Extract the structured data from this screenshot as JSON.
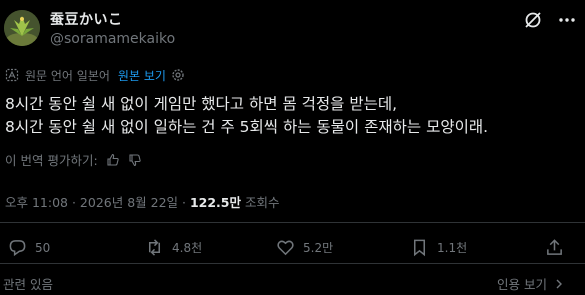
{
  "author": {
    "display_name": "蚕豆かいこ",
    "handle": "@soramamekaiko",
    "avatar_icon": "plant-avatar"
  },
  "translation": {
    "label": "원문 언어 일본어",
    "original_link": "원본 보기",
    "settings_icon": "gear-icon"
  },
  "tweet": {
    "lines": [
      "8시간 동안 쉴 새 없이 게임만 했다고 하면 몸 걱정을 받는데,",
      "8시간 동안 쉴 새 없이 일하는 건 주 5회씩 하는 동물이 존재하는 모양이래."
    ]
  },
  "rate_translation": {
    "label": "이 번역 평가하기:"
  },
  "meta": {
    "timestamp": "오후 11:08 · 2026년 8월 22일 · ",
    "views_count": "122.5만",
    "views_label": " 조회수"
  },
  "actions": {
    "replies": "50",
    "reposts": "4.8천",
    "likes": "5.2만",
    "bookmarks": "1.1천"
  },
  "footer": {
    "related_posts": "관련 있음",
    "quotes": "인용 보기"
  },
  "colors": {
    "background": "#000000",
    "text": "#e7e9ea",
    "muted": "#71767b",
    "link": "#1d9bf0"
  }
}
